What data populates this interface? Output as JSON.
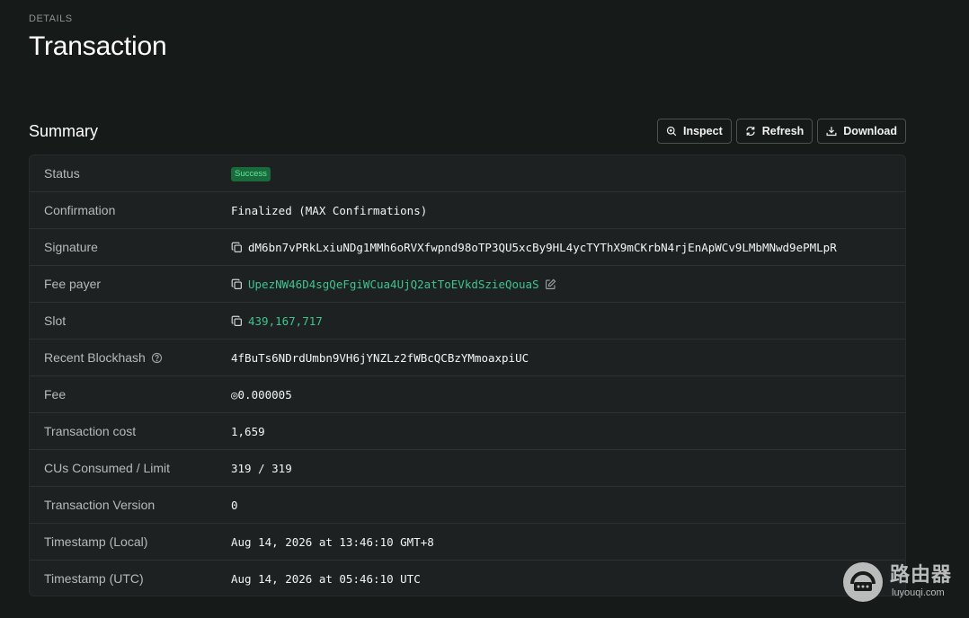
{
  "header": {
    "kicker": "DETAILS",
    "title": "Transaction"
  },
  "summary": {
    "title": "Summary",
    "actions": {
      "inspect": "Inspect",
      "refresh": "Refresh",
      "download": "Download"
    }
  },
  "rows": {
    "status": {
      "label": "Status",
      "value": "Success"
    },
    "confirmation": {
      "label": "Confirmation",
      "value": "Finalized (MAX Confirmations)"
    },
    "signature": {
      "label": "Signature",
      "value": "dM6bn7vPRkLxiuNDg1MMh6oRVXfwpnd98oTP3QU5xcBy9HL4ycTYThX9mCKrbN4rjEnApWCv9LMbMNwd9ePMLpR"
    },
    "fee_payer": {
      "label": "Fee payer",
      "value": "UpezNW46D4sgQeFgiWCua4UjQ2atToEVkdSzieQouaS"
    },
    "slot": {
      "label": "Slot",
      "value": "439,167,717"
    },
    "recent_blockhash": {
      "label": "Recent Blockhash",
      "value": "4fBuTs6NDrdUmbn9VH6jYNZLz2fWBcQCBzYMmoaxpiUC"
    },
    "fee": {
      "label": "Fee",
      "value": "◎0.000005"
    },
    "transaction_cost": {
      "label": "Transaction cost",
      "value": "1,659"
    },
    "cus": {
      "label": "CUs Consumed / Limit",
      "value": "319 / 319"
    },
    "version": {
      "label": "Transaction Version",
      "value": "0"
    },
    "timestamp_local": {
      "label": "Timestamp (Local)",
      "value": "Aug 14, 2026 at 13:46:10 GMT+8"
    },
    "timestamp_utc": {
      "label": "Timestamp (UTC)",
      "value": "Aug 14, 2026 at 05:46:10 UTC"
    }
  },
  "icons": {
    "inspect": "magnifier-icon",
    "refresh": "refresh-icon",
    "download": "download-icon",
    "copy": "copy-icon",
    "help": "help-circle-icon",
    "edit": "edit-icon"
  },
  "colors": {
    "background": "#161a19",
    "card": "#1d2121",
    "link": "#3fc48f",
    "success_badge_bg": "#1a6b3c",
    "success_badge_text": "#62e39f"
  },
  "watermark": {
    "main": "路由器",
    "sub": "luyouqi.com"
  }
}
